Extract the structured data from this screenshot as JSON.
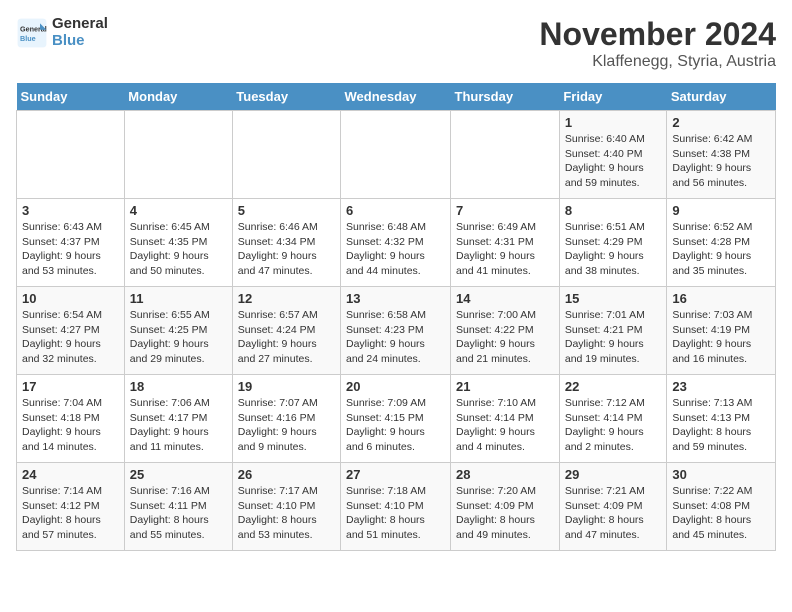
{
  "header": {
    "logo_line1": "General",
    "logo_line2": "Blue",
    "month": "November 2024",
    "location": "Klaffenegg, Styria, Austria"
  },
  "weekdays": [
    "Sunday",
    "Monday",
    "Tuesday",
    "Wednesday",
    "Thursday",
    "Friday",
    "Saturday"
  ],
  "weeks": [
    [
      {
        "day": "",
        "info": ""
      },
      {
        "day": "",
        "info": ""
      },
      {
        "day": "",
        "info": ""
      },
      {
        "day": "",
        "info": ""
      },
      {
        "day": "",
        "info": ""
      },
      {
        "day": "1",
        "info": "Sunrise: 6:40 AM\nSunset: 4:40 PM\nDaylight: 9 hours\nand 59 minutes."
      },
      {
        "day": "2",
        "info": "Sunrise: 6:42 AM\nSunset: 4:38 PM\nDaylight: 9 hours\nand 56 minutes."
      }
    ],
    [
      {
        "day": "3",
        "info": "Sunrise: 6:43 AM\nSunset: 4:37 PM\nDaylight: 9 hours\nand 53 minutes."
      },
      {
        "day": "4",
        "info": "Sunrise: 6:45 AM\nSunset: 4:35 PM\nDaylight: 9 hours\nand 50 minutes."
      },
      {
        "day": "5",
        "info": "Sunrise: 6:46 AM\nSunset: 4:34 PM\nDaylight: 9 hours\nand 47 minutes."
      },
      {
        "day": "6",
        "info": "Sunrise: 6:48 AM\nSunset: 4:32 PM\nDaylight: 9 hours\nand 44 minutes."
      },
      {
        "day": "7",
        "info": "Sunrise: 6:49 AM\nSunset: 4:31 PM\nDaylight: 9 hours\nand 41 minutes."
      },
      {
        "day": "8",
        "info": "Sunrise: 6:51 AM\nSunset: 4:29 PM\nDaylight: 9 hours\nand 38 minutes."
      },
      {
        "day": "9",
        "info": "Sunrise: 6:52 AM\nSunset: 4:28 PM\nDaylight: 9 hours\nand 35 minutes."
      }
    ],
    [
      {
        "day": "10",
        "info": "Sunrise: 6:54 AM\nSunset: 4:27 PM\nDaylight: 9 hours\nand 32 minutes."
      },
      {
        "day": "11",
        "info": "Sunrise: 6:55 AM\nSunset: 4:25 PM\nDaylight: 9 hours\nand 29 minutes."
      },
      {
        "day": "12",
        "info": "Sunrise: 6:57 AM\nSunset: 4:24 PM\nDaylight: 9 hours\nand 27 minutes."
      },
      {
        "day": "13",
        "info": "Sunrise: 6:58 AM\nSunset: 4:23 PM\nDaylight: 9 hours\nand 24 minutes."
      },
      {
        "day": "14",
        "info": "Sunrise: 7:00 AM\nSunset: 4:22 PM\nDaylight: 9 hours\nand 21 minutes."
      },
      {
        "day": "15",
        "info": "Sunrise: 7:01 AM\nSunset: 4:21 PM\nDaylight: 9 hours\nand 19 minutes."
      },
      {
        "day": "16",
        "info": "Sunrise: 7:03 AM\nSunset: 4:19 PM\nDaylight: 9 hours\nand 16 minutes."
      }
    ],
    [
      {
        "day": "17",
        "info": "Sunrise: 7:04 AM\nSunset: 4:18 PM\nDaylight: 9 hours\nand 14 minutes."
      },
      {
        "day": "18",
        "info": "Sunrise: 7:06 AM\nSunset: 4:17 PM\nDaylight: 9 hours\nand 11 minutes."
      },
      {
        "day": "19",
        "info": "Sunrise: 7:07 AM\nSunset: 4:16 PM\nDaylight: 9 hours\nand 9 minutes."
      },
      {
        "day": "20",
        "info": "Sunrise: 7:09 AM\nSunset: 4:15 PM\nDaylight: 9 hours\nand 6 minutes."
      },
      {
        "day": "21",
        "info": "Sunrise: 7:10 AM\nSunset: 4:14 PM\nDaylight: 9 hours\nand 4 minutes."
      },
      {
        "day": "22",
        "info": "Sunrise: 7:12 AM\nSunset: 4:14 PM\nDaylight: 9 hours\nand 2 minutes."
      },
      {
        "day": "23",
        "info": "Sunrise: 7:13 AM\nSunset: 4:13 PM\nDaylight: 8 hours\nand 59 minutes."
      }
    ],
    [
      {
        "day": "24",
        "info": "Sunrise: 7:14 AM\nSunset: 4:12 PM\nDaylight: 8 hours\nand 57 minutes."
      },
      {
        "day": "25",
        "info": "Sunrise: 7:16 AM\nSunset: 4:11 PM\nDaylight: 8 hours\nand 55 minutes."
      },
      {
        "day": "26",
        "info": "Sunrise: 7:17 AM\nSunset: 4:10 PM\nDaylight: 8 hours\nand 53 minutes."
      },
      {
        "day": "27",
        "info": "Sunrise: 7:18 AM\nSunset: 4:10 PM\nDaylight: 8 hours\nand 51 minutes."
      },
      {
        "day": "28",
        "info": "Sunrise: 7:20 AM\nSunset: 4:09 PM\nDaylight: 8 hours\nand 49 minutes."
      },
      {
        "day": "29",
        "info": "Sunrise: 7:21 AM\nSunset: 4:09 PM\nDaylight: 8 hours\nand 47 minutes."
      },
      {
        "day": "30",
        "info": "Sunrise: 7:22 AM\nSunset: 4:08 PM\nDaylight: 8 hours\nand 45 minutes."
      }
    ]
  ]
}
